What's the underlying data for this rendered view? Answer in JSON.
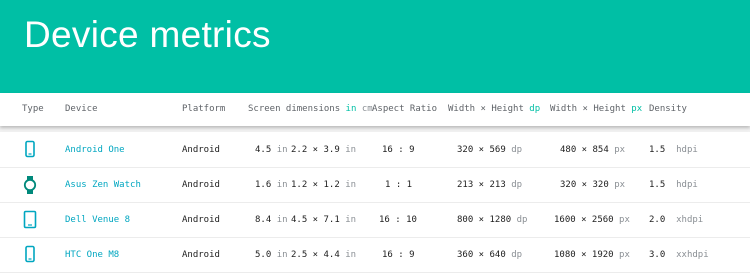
{
  "page": {
    "title": "Device metrics"
  },
  "colors": {
    "header": "#00bfa5",
    "accent": "#00bfa5",
    "device_link": "#00a6c0"
  },
  "columns": {
    "type": "Type",
    "device": "Device",
    "platform": "Platform",
    "screen_dimensions": "Screen dimensions",
    "screen_unit_in": "in",
    "screen_unit_cm": "cm",
    "aspect_ratio": "Aspect Ratio",
    "wh_dp_label": "Width × Height",
    "wh_dp_unit": "dp",
    "wh_px_label": "Width × Height",
    "wh_px_unit": "px",
    "density": "Density"
  },
  "rows": [
    {
      "icon": "phone-icon",
      "device": "Android One",
      "platform": "Android",
      "diag": "4.5",
      "diag_unit": "in",
      "dims": "2.2 × 3.9",
      "dims_unit": "in",
      "aspect": "16 : 9",
      "dp": "320 × 569",
      "dp_unit": "dp",
      "px": "480 × 854",
      "px_unit": "px",
      "density": "1.5",
      "density_name": "hdpi"
    },
    {
      "icon": "watch-icon",
      "device": "Asus Zen Watch",
      "platform": "Android",
      "diag": "1.6",
      "diag_unit": "in",
      "dims": "1.2 × 1.2",
      "dims_unit": "in",
      "aspect": "1 : 1",
      "dp": "213 × 213",
      "dp_unit": "dp",
      "px": "320 × 320",
      "px_unit": "px",
      "density": "1.5",
      "density_name": "hdpi"
    },
    {
      "icon": "tablet-icon",
      "device": "Dell Venue 8",
      "platform": "Android",
      "diag": "8.4",
      "diag_unit": "in",
      "dims": "4.5 × 7.1",
      "dims_unit": "in",
      "aspect": "16 : 10",
      "dp": "800 × 1280",
      "dp_unit": "dp",
      "px": "1600 × 2560",
      "px_unit": "px",
      "density": "2.0",
      "density_name": "xhdpi"
    },
    {
      "icon": "phone-icon",
      "device": "HTC One M8",
      "platform": "Android",
      "diag": "5.0",
      "diag_unit": "in",
      "dims": "2.5 × 4.4",
      "dims_unit": "in",
      "aspect": "16 : 9",
      "dp": "360 × 640",
      "dp_unit": "dp",
      "px": "1080 × 1920",
      "px_unit": "px",
      "density": "3.0",
      "density_name": "xxhdpi"
    }
  ]
}
